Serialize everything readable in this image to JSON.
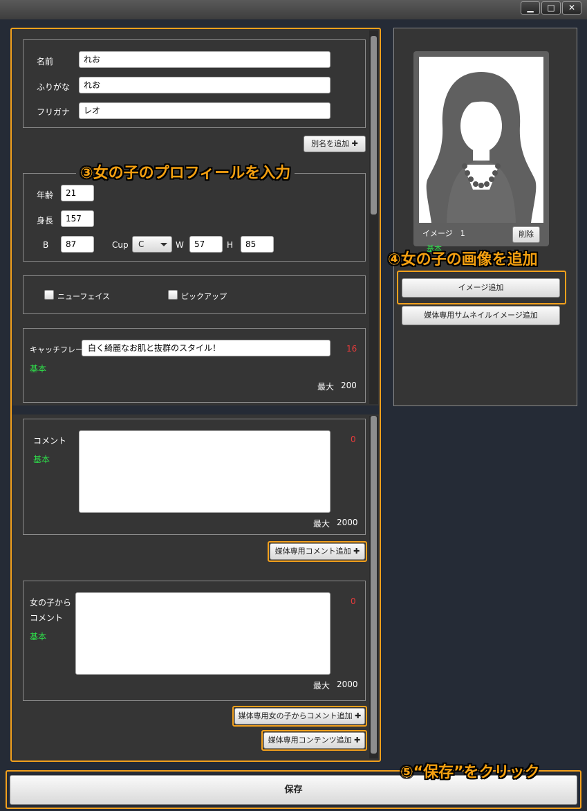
{
  "window": {
    "minimize": "▁",
    "maximize": "□",
    "close": "✕"
  },
  "names": {
    "name_label": "名前",
    "name_value": "れお",
    "furigana_label": "ふりがな",
    "furigana_value": "れお",
    "katakana_label": "フリガナ",
    "katakana_value": "レオ",
    "add_alias_label": "別名を追加 ✚"
  },
  "annotations": {
    "profile": "③女の子のプロフィールを入力",
    "image": "④女の子の画像を追加",
    "save": "⑤“保存”をクリック"
  },
  "body": {
    "age_label": "年齢",
    "age_value": "21",
    "height_label": "身長",
    "height_value": "157",
    "b_label": "B",
    "b_value": "87",
    "cup_label": "Cup",
    "cup_value": "C",
    "w_label": "W",
    "w_value": "57",
    "h_label": "H",
    "h_value": "85"
  },
  "flags": {
    "new_face": "ニューフェイス",
    "pickup": "ピックアップ"
  },
  "catchphrase": {
    "label": "キャッチフレーズ",
    "value": "白く綺麗なお肌と抜群のスタイル！",
    "basic": "基本",
    "count": "16",
    "max_label": "最大",
    "max_value": "200"
  },
  "comment": {
    "label": "コメント",
    "basic": "基本",
    "count": "0",
    "max_label": "最大",
    "max_value": "2000",
    "add_media_label": "媒体専用コメント追加 ✚"
  },
  "girl_comment": {
    "label_line1": "女の子から",
    "label_line2": "コメント",
    "basic": "基本",
    "count": "0",
    "max_label": "最大",
    "max_value": "2000",
    "add_media_label": "媒体専用女の子からコメント追加 ✚",
    "add_content_label": "媒体専用コンテンツ追加 ✚"
  },
  "image_panel": {
    "caption": "イメージ　1",
    "delete_label": "削除",
    "basic": "基本",
    "add_image_label": "イメージ追加",
    "add_thumb_label": "媒体専用サムネイルイメージ追加"
  },
  "save_label": "保存",
  "colors": {
    "accent_orange": "#f4a11c",
    "basic_green": "#2ee04a",
    "count_red": "#e63b3b"
  }
}
